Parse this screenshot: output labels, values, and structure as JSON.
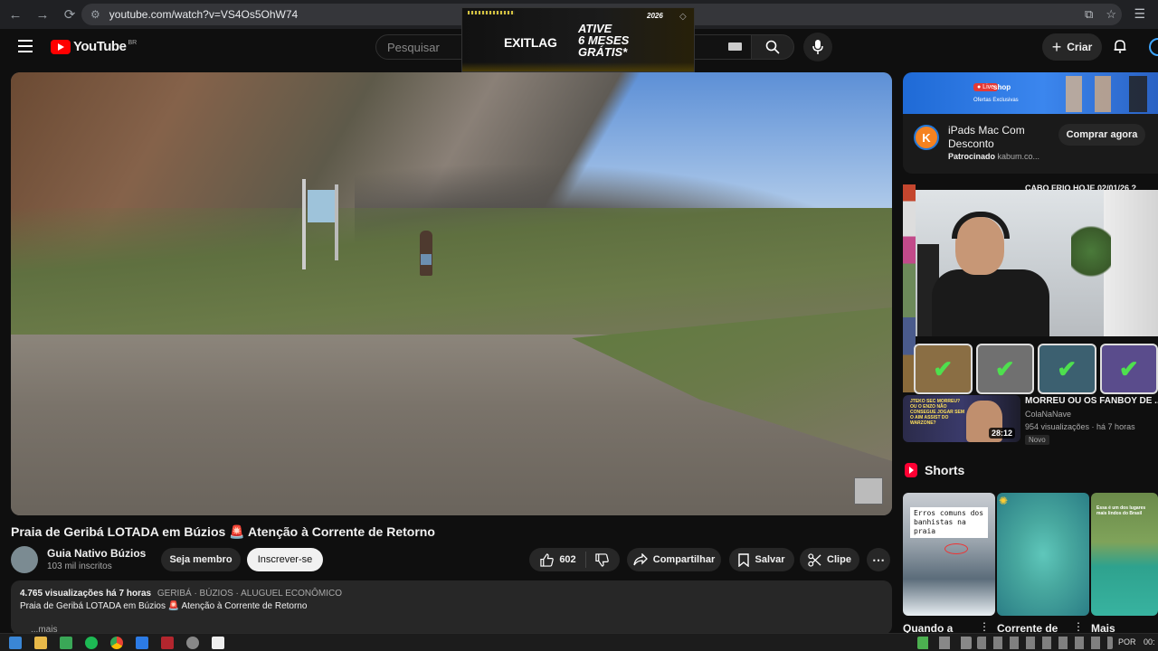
{
  "browser": {
    "url": "youtube.com/watch?v=VS4Os5OhW74",
    "back": "←",
    "forward": "→",
    "reload": "⟳",
    "tune_icon": "⚙"
  },
  "header": {
    "logo_text": "YouTube",
    "logo_country": "BR",
    "search_placeholder": "Pesquisar",
    "create_label": "Criar",
    "create_plus": "+",
    "mic": "🎤",
    "bell": "🔔"
  },
  "ad_overlay": {
    "brand": "EXITLAG",
    "headline": "ATIVE\n6 MESES\nGRÁTIS*",
    "badge": "2026"
  },
  "video": {
    "title": "Praia de Geribá LOTADA em Búzios 🚨 Atenção à Corrente de Retorno",
    "channel_name": "Guia Nativo Búzios",
    "channel_subs": "103 mil inscritos",
    "member_label": "Seja membro",
    "subscribe_label": "Inscrever-se",
    "likes": "602",
    "share_label": "Compartilhar",
    "save_label": "Salvar",
    "clip_label": "Clipe",
    "more_label": "⋯"
  },
  "description": {
    "stats": "4.765 visualizações  há 7 horas",
    "tags": "GERIBÁ · BÚZIOS · ALUGUEL ECONÔMICO",
    "text": "Praia de Geribá LOTADA em Búzios 🚨 Atenção à Corrente de Retorno",
    "more": "...mais"
  },
  "sidebar": {
    "ad": {
      "live": "● Live",
      "shop": "shop",
      "offers": "Ofertas Exclusivas",
      "title": "iPads Mac Com Desconto",
      "sponsored": "Patrocinado",
      "domain": "kabum.co...",
      "cta": "Comprar agora",
      "icon_letter": "K"
    },
    "top_rec_title": "CABO FRIO HOJE 02/01/26 ?",
    "rec": {
      "title": "MORREU OU OS FANBOY DE ...",
      "channel": "ColaNaNave",
      "meta": "954 visualizações · há 7 horas",
      "badge": "Novo",
      "duration": "28:12",
      "thumb_text": "JTEKO SEC MORREU? OU O ENZO NÃO CONSEGUE JOGAR SEM O AIM ASSIST DO WARZONE?"
    },
    "shorts_title": "Shorts",
    "shorts": [
      {
        "label": "Quando a",
        "caption": "Erros comuns dos banhistas na praia"
      },
      {
        "label": "Corrente de",
        "caption": ""
      },
      {
        "label": "Mais",
        "caption": "Essa é um dos lugares mais lindos do Brasil"
      }
    ],
    "checkmark": "✔"
  },
  "taskbar": {
    "lang": "POR",
    "time": "00:"
  },
  "colors": {
    "background": "#0f0f0f",
    "brand_red": "#ff0000",
    "subscribe_bg": "#f1f1f1",
    "pill_bg": "#272727"
  }
}
